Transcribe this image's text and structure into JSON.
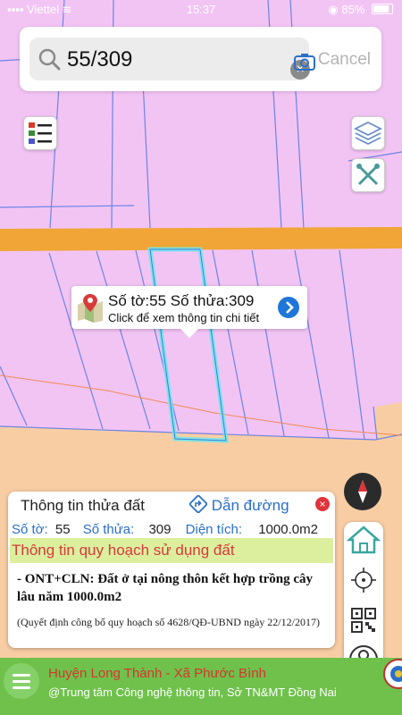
{
  "status_bar": {
    "carrier": "Viettel",
    "time": "15:37",
    "battery": "85%",
    "battery_level": 0.85
  },
  "search": {
    "query": "55/309",
    "cancel_label": "Cancel"
  },
  "map_popup": {
    "title": "Số tờ:55 Số thửa:309",
    "subtitle": "Click để xem thông tin chi tiết"
  },
  "info_panel": {
    "title": "Thông tin thửa đất",
    "directions_label": "Dẫn đường",
    "sheet_label": "Số tờ:",
    "sheet_value": "55",
    "parcel_label": "Số thửa:",
    "parcel_value": "309",
    "area_label": "Diện tích:",
    "area_value": "1000.0m2",
    "planning_header": "Thông tin quy hoạch sử dụng đất",
    "land_use": "- ONT+CLN: Đất ở tại nông thôn kết hợp trồng cây lâu năm 1000.0m2",
    "decision_note": "(Quyết định công bố quy hoạch số 4628/QĐ-UBND ngày 22/12/2017)"
  },
  "footer": {
    "district": "Huyện Long Thành - Xã Phước Bình",
    "credit": "@Trung tâm Công nghệ thông tin, Sở TN&MT Đồng Nai"
  },
  "colors": {
    "residential_zone": "#f2c4f4",
    "agricultural_zone": "#f9cda4",
    "road": "#f0a536",
    "selected_parcel": "#6ee8ec",
    "parcel_line": "#6c84e4",
    "footer_bg": "#6fc14b",
    "accent_blue": "#2a6fc9",
    "alert_red": "#d83a3a"
  },
  "icons": {
    "search": "search-icon",
    "camera": "camera-icon",
    "clear": "clear-icon",
    "legend": "legend-icon",
    "layers": "layers-icon",
    "tools": "tools-icon",
    "map_pin": "map-pin-icon",
    "directions": "directions-icon",
    "compass": "compass-icon",
    "home": "home-icon",
    "locate": "locate-icon",
    "qr": "qr-icon",
    "profile": "profile-icon",
    "menu": "menu-icon"
  }
}
